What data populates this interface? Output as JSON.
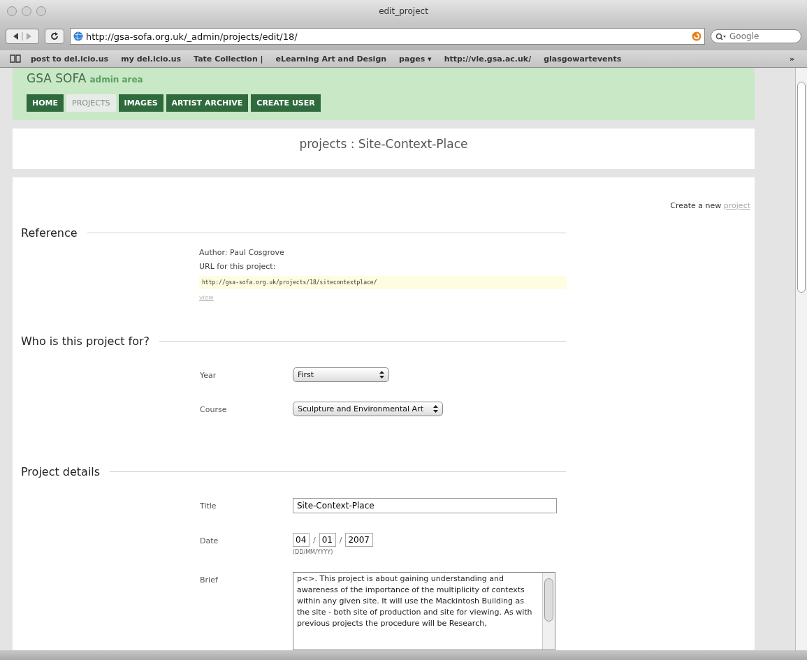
{
  "window": {
    "title": "edit_project"
  },
  "toolbar": {
    "url": "http://gsa-sofa.org.uk/_admin/projects/edit/18/",
    "search": {
      "placeholder": "Google"
    }
  },
  "bookmarks": [
    "post to del.icio.us",
    "my del.icio.us",
    "Tate Collection |",
    "eLearning Art and Design",
    "pages ▾",
    "http://vle.gsa.ac.uk/",
    "glasgowartevents"
  ],
  "bookmarks_more": "»",
  "site": {
    "name": "GSA SOFA",
    "subtitle": "admin area"
  },
  "nav": [
    {
      "label": "HOME",
      "selected": false
    },
    {
      "label": "PROJECTS",
      "selected": true
    },
    {
      "label": "IMAGES",
      "selected": false
    },
    {
      "label": "ARTIST ARCHIVE",
      "selected": false
    },
    {
      "label": "CREATE USER",
      "selected": false
    }
  ],
  "page_title": "projects : Site-Context-Place",
  "create_link": {
    "text": "Create a new ",
    "link": "project"
  },
  "reference": {
    "heading": "Reference",
    "author": "Author: Paul Cosgrove",
    "url_label": "URL for this project:",
    "url": "http://gsa-sofa.org.uk/projects/18/sitecontextplace/",
    "view_link": "view"
  },
  "audience": {
    "heading": "Who is this project for?",
    "fields": [
      {
        "label": "Year",
        "value": "First"
      },
      {
        "label": "Course",
        "value": "Sculpture and Environmental Art"
      }
    ]
  },
  "details": {
    "heading": "Project details",
    "title": {
      "label": "Title",
      "value": "Site-Context-Place"
    },
    "date": {
      "label": "Date",
      "day": "04",
      "month": "01",
      "year": "2007",
      "separator": "/",
      "hint": "(DD/MM/YYYY)"
    },
    "brief": {
      "label": "Brief",
      "value": "p<>. This project is about gaining understanding and awareness of the importance of the multiplicity of contexts within any given site. It will use the Mackintosh Building as the site - both site of production and site for viewing. As with previous projects the procedure will be Research,"
    }
  }
}
